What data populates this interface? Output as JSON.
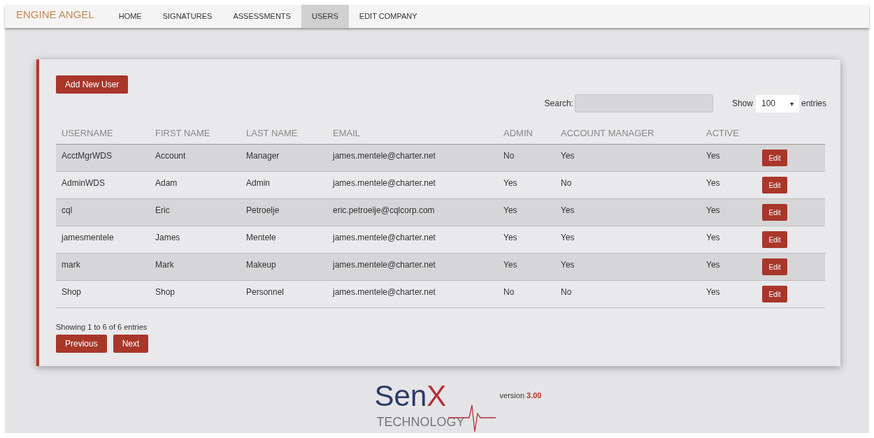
{
  "nav": {
    "brand": "ENGINE ANGEL",
    "items": [
      {
        "label": "HOME",
        "selected": false
      },
      {
        "label": "SIGNATURES",
        "selected": false
      },
      {
        "label": "ASSESSMENTS",
        "selected": false
      },
      {
        "label": "USERS",
        "selected": true
      },
      {
        "label": "EDIT COMPANY",
        "selected": false
      }
    ]
  },
  "add_button": "Add New User",
  "search": {
    "label": "Search:"
  },
  "length": {
    "before": "Show",
    "value": "100",
    "caret": "▾",
    "after": "entries"
  },
  "table": {
    "columns": [
      "USERNAME",
      "FIRST NAME",
      "LAST NAME",
      "EMAIL",
      "ADMIN",
      "ACCOUNT MANAGER",
      "ACTIVE"
    ],
    "rows": [
      {
        "cells": [
          "AcctMgrWDS",
          "Account",
          "Manager",
          "james.mentele@charter.net",
          "No",
          "Yes",
          "Yes"
        ],
        "action": "Edit"
      },
      {
        "cells": [
          "AdminWDS",
          "Adam",
          "Admin",
          "james.mentele@charter.net",
          "Yes",
          "No",
          "Yes"
        ],
        "action": "Edit"
      },
      {
        "cells": [
          "cql",
          "Eric",
          "Petroelje",
          "eric.petroelje@cqlcorp.com",
          "Yes",
          "Yes",
          "Yes"
        ],
        "action": "Edit"
      },
      {
        "cells": [
          "jamesmentele",
          "James",
          "Mentele",
          "james.mentele@charter.net",
          "Yes",
          "Yes",
          "Yes"
        ],
        "action": "Edit"
      },
      {
        "cells": [
          "mark",
          "Mark",
          "Makeup",
          "james.mentele@charter.net",
          "Yes",
          "Yes",
          "Yes"
        ],
        "action": "Edit"
      },
      {
        "cells": [
          "Shop",
          "Shop",
          "Personnel",
          "james.mentele@charter.net",
          "No",
          "No",
          "Yes"
        ],
        "action": "Edit"
      }
    ]
  },
  "info": "Showing 1 to 6 of 6 entries",
  "pagination": [
    "Previous",
    "Next"
  ],
  "footer": {
    "logo_main": "Sen",
    "logo_accent": "X",
    "logo_sub": "TECHNOLOGY",
    "version_label": "version",
    "version_number": "3.00"
  }
}
